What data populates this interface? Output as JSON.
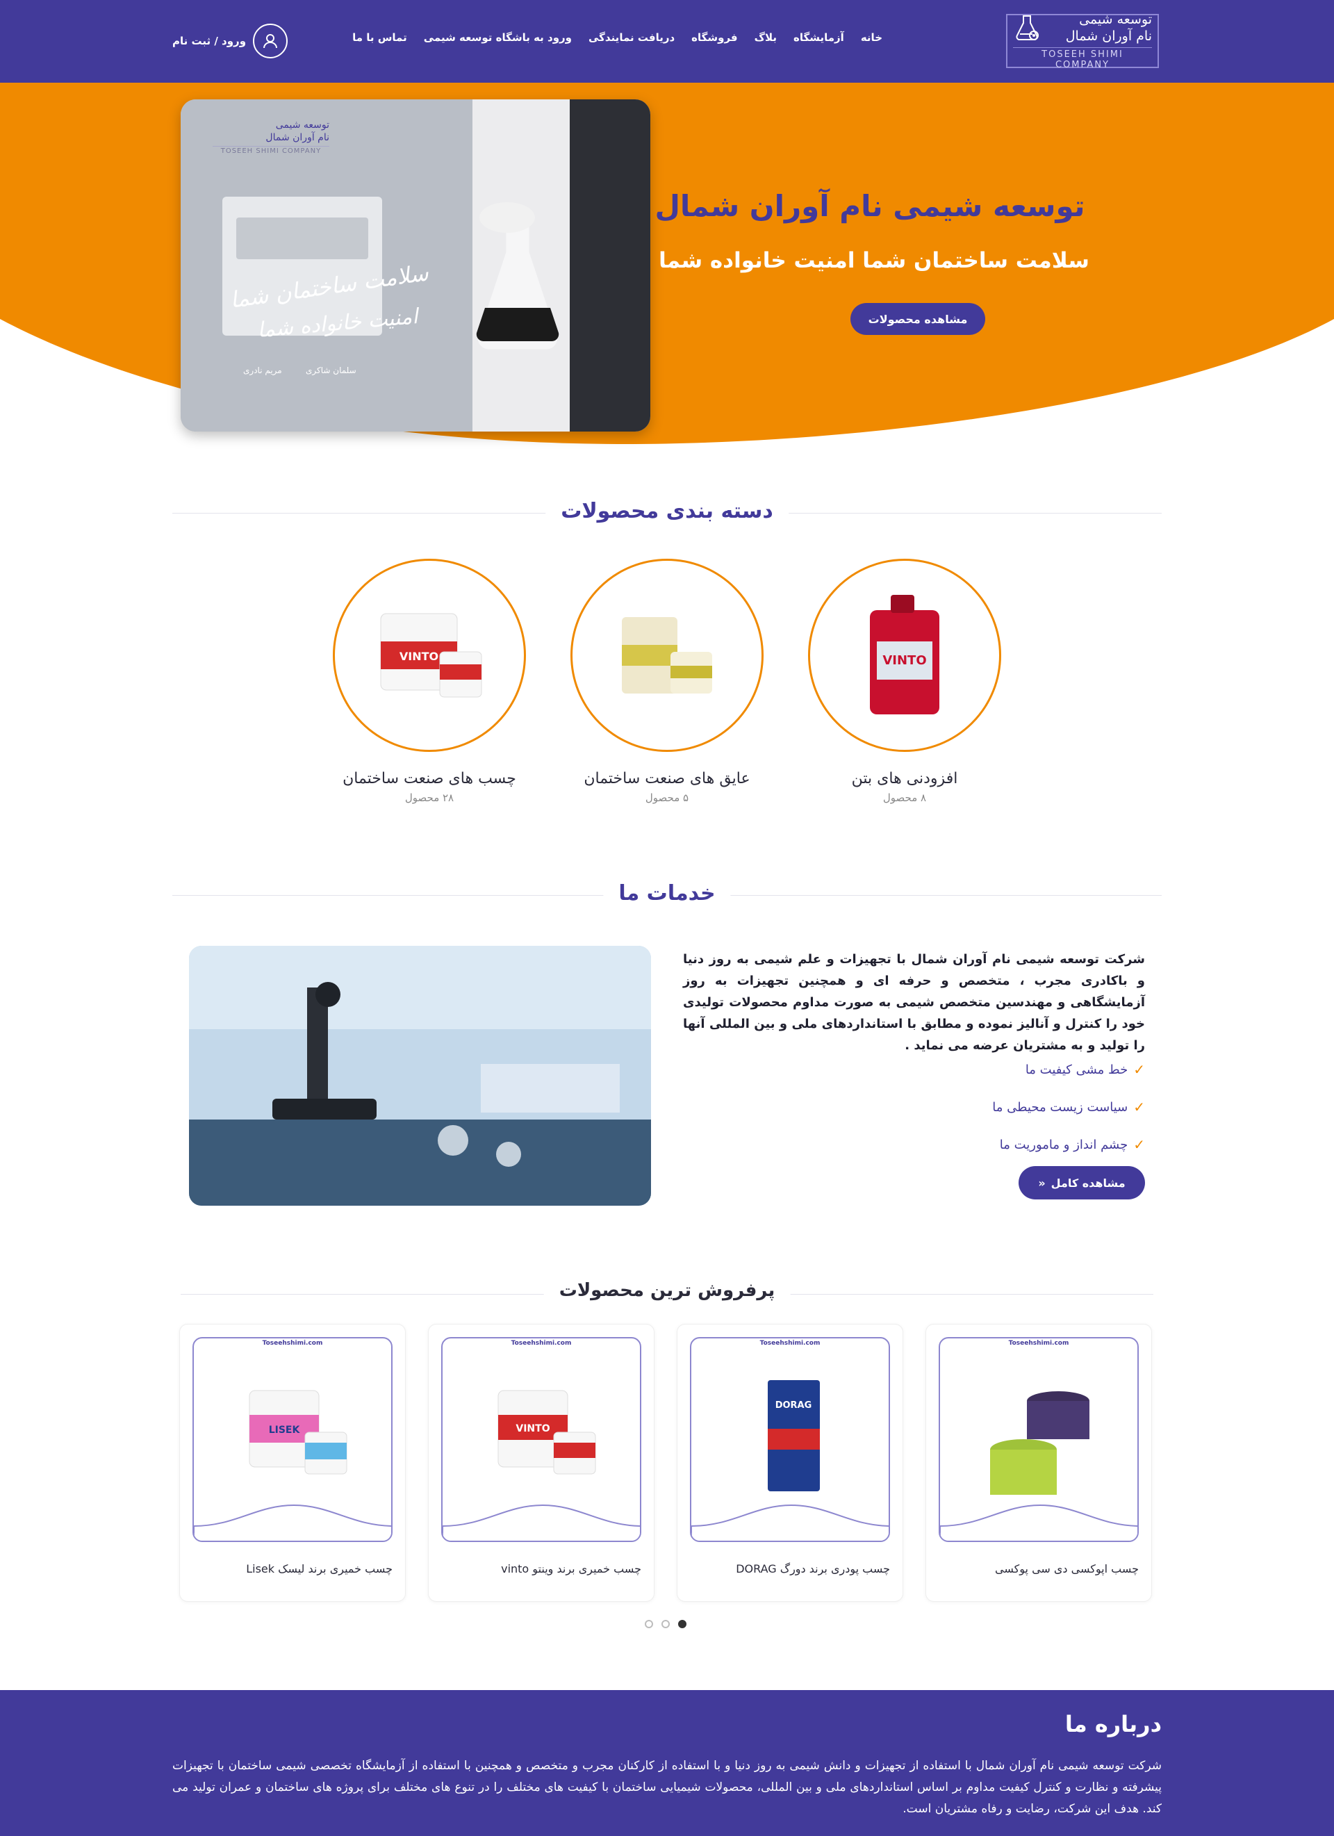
{
  "header": {
    "logo": {
      "line1": "توسعه شیمی",
      "line2": "نام آوران شمال",
      "english": "TOSEEH SHIMI COMPANY"
    },
    "nav": [
      "خانه",
      "آزمایشگاه",
      "بلاگ",
      "فروشگاه",
      "دریافت نمایندگی",
      "ورود به باشگاه توسعه شیمی",
      "تماس با ما"
    ],
    "login_label": "ورود / ثبت نام"
  },
  "hero": {
    "title": "توسعه شیمی نام آوران شمال",
    "subtitle": "سلامت ساختمان شما امنیت خانواده شما",
    "button": "مشاهده محصولات",
    "image_logo": {
      "line1": "توسعه شیمی",
      "line2": "نام آوران شمال",
      "english": "TOSEEH SHIMI COMPANY"
    },
    "image_signature_line1": "سلامت ساختمان شما",
    "image_signature_line2": "امنیت خانواده شما",
    "image_caption1": "سلمان شاکری",
    "image_caption2": "مریم نادری"
  },
  "categories": {
    "title": "دسته بندی محصولات",
    "items": [
      {
        "name": "افزودنی های بتن",
        "count": "۸ محصول",
        "image_label": "VINTO"
      },
      {
        "name": "عایق های صنعت ساختمان",
        "count": "۵ محصول",
        "image_label": ""
      },
      {
        "name": "چسب های صنعت ساختمان",
        "count": "۲۸ محصول",
        "image_label": "VINTO"
      }
    ]
  },
  "services": {
    "title": "خدمات ما",
    "description": "شرکت توسعه شیمی نام آوران شمال با تجهیزات و علم شیمی به روز دنیا و باکادری مجرب ، متخصص و حرفه ای و همچنین تجهیزات به روز آزمایشگاهی و مهندسین متخصص شیمی به صورت مداوم محصولات تولیدی خود را کنترل و آنالیز نموده و مطابق با استانداردهای ملی و بین المللی آنها را تولید و به مشتریان عرضه می نماید .",
    "checklist": [
      "خط مشی کیفیت ما",
      "سیاست زیست محیطی ما",
      "چشم انداز و ماموریت ما"
    ],
    "button": "مشاهده کامل"
  },
  "bestsellers": {
    "title": "پرفروش ترین محصولات",
    "site_label": "Toseehshimi.com",
    "products": [
      {
        "name": "چسب اپوکسی دی سی پوکسی",
        "image_label": ""
      },
      {
        "name": "چسب پودری برند دورگ DORAG",
        "image_label": "DORAG"
      },
      {
        "name": "چسب خمیری برند وینتو vinto",
        "image_label": "VINTO"
      },
      {
        "name": "چسب خمیری برند لیسک Lisek",
        "image_label": "LISEK"
      }
    ],
    "active_page": 0
  },
  "about": {
    "title": "درباره ما",
    "text": "شرکت توسعه شیمی نام آوران شمال با استفاده از تجهیزات و دانش شیمی به روز دنیا و با استفاده از کارکنان مجرب و متخصص و همچنین با استفاده از آزمایشگاه تخصصی شیمی ساختمان با تجهیزات پیشرفته و نظارت و کنترل کیفیت مداوم بر اساس استانداردهای ملی و بین المللی، محصولات شیمیایی ساختمان با کیفیت های مختلف را در تنوع های مختلف برای پروژه های ساختمان و عمران تولید می کند. هدف این شرکت، رضایت و رفاه مشتریان است."
  },
  "colors": {
    "primary": "#423a9a",
    "accent": "#f08a00",
    "white": "#ffffff"
  },
  "icons": {
    "logo": "flask-gear-icon",
    "login": "user-icon",
    "check": "check-icon",
    "button_arrow": "double-chevron-icon"
  }
}
